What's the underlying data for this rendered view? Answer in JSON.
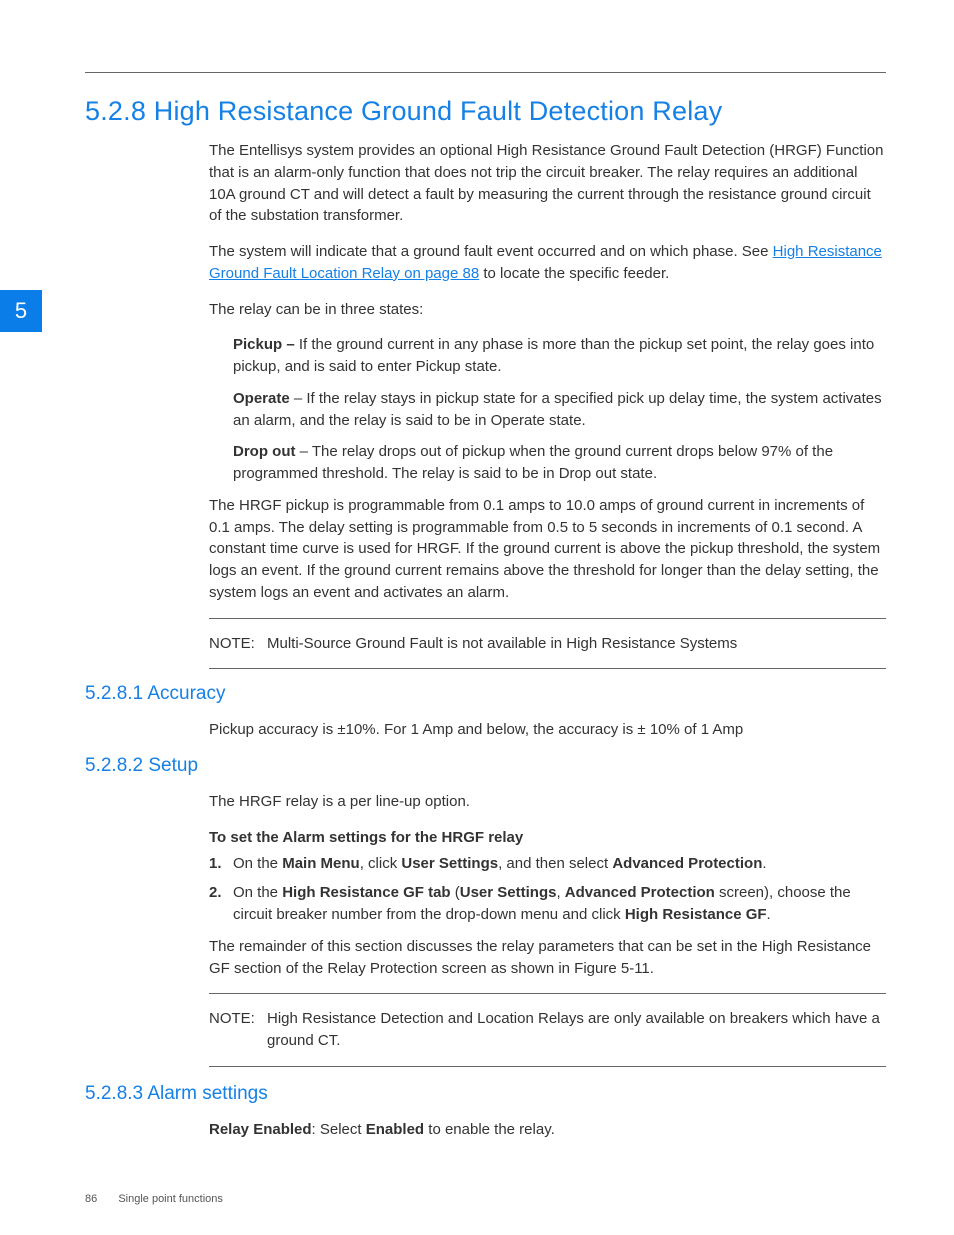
{
  "chapter_tab": "5",
  "section_title": "5.2.8 High Resistance Ground Fault Detection Relay",
  "p1": "The Entellisys system provides an optional High Resistance Ground Fault Detection (HRGF) Function that is an alarm-only function that does not trip the circuit breaker. The relay requires an additional 10A ground CT and will detect a fault by measuring the current through the resistance ground circuit of the substation transformer.",
  "p2_pre": "The system will indicate that a ground fault event occurred and on which phase. See ",
  "p2_link": "High Resistance Ground Fault Location Relay on page 88",
  "p2_post": " to locate the specific feeder.",
  "p3": "The relay can be in three states:",
  "states": {
    "pickup_label": "Pickup –",
    "pickup_text": " If the ground current in any phase is more than the pickup set point, the relay goes into pickup, and is said to enter Pickup state.",
    "operate_label": "Operate",
    "operate_text": " – If the relay stays in pickup state for a specified pick up delay time, the system activates an alarm, and the relay is said to be in Operate state.",
    "dropout_label": "Drop out",
    "dropout_text": " – The relay drops out of pickup when the ground current drops below 97% of the programmed threshold. The relay is said to be in Drop out state."
  },
  "p4": "The HRGF pickup is programmable from 0.1 amps to 10.0 amps of ground current in increments of 0.1 amps. The delay setting is programmable from 0.5 to 5 seconds in increments of 0.1 second. A constant time curve is used for HRGF. If the ground current is above the pickup threshold, the system logs an event. If the ground current remains above the threshold for longer than the delay setting, the system logs an event and activates an alarm.",
  "note1_label": "NOTE:",
  "note1_text": "Multi-Source Ground Fault is not available in High Resistance Systems",
  "h_accuracy": "5.2.8.1 Accuracy",
  "accuracy_p": "Pickup accuracy is ±10%. For 1 Amp and below, the accuracy is ± 10% of 1 Amp",
  "h_setup": "5.2.8.2 Setup",
  "setup_p1": "The HRGF relay is a per line-up option.",
  "setup_bold": "To set the Alarm settings for the HRGF relay",
  "setup_steps": {
    "s1_a": "On the ",
    "s1_b": "Main Menu",
    "s1_c": ", click ",
    "s1_d": "User Settings",
    "s1_e": ", and then select ",
    "s1_f": "Advanced Protection",
    "s1_g": ".",
    "s2_a": "On the ",
    "s2_b": "High Resistance GF tab",
    "s2_c": " (",
    "s2_d": "User Settings",
    "s2_e": ", ",
    "s2_f": "Advanced Protection",
    "s2_g": " screen), choose the circuit breaker number from the drop-down menu and click ",
    "s2_h": "High Resistance GF",
    "s2_i": "."
  },
  "setup_p2": "The remainder of this section discusses the relay parameters that can be set in the High Resistance GF section of the Relay Protection screen as shown in Figure 5-11.",
  "note2_label": "NOTE:",
  "note2_text": "High Resistance Detection and Location Relays are only available on breakers which have a ground CT.",
  "h_alarm": "5.2.8.3 Alarm settings",
  "alarm_a": "Relay Enabled",
  "alarm_b": ": Select ",
  "alarm_c": "Enabled",
  "alarm_d": " to enable the relay.",
  "footer_page": "86",
  "footer_title": "Single point functions"
}
